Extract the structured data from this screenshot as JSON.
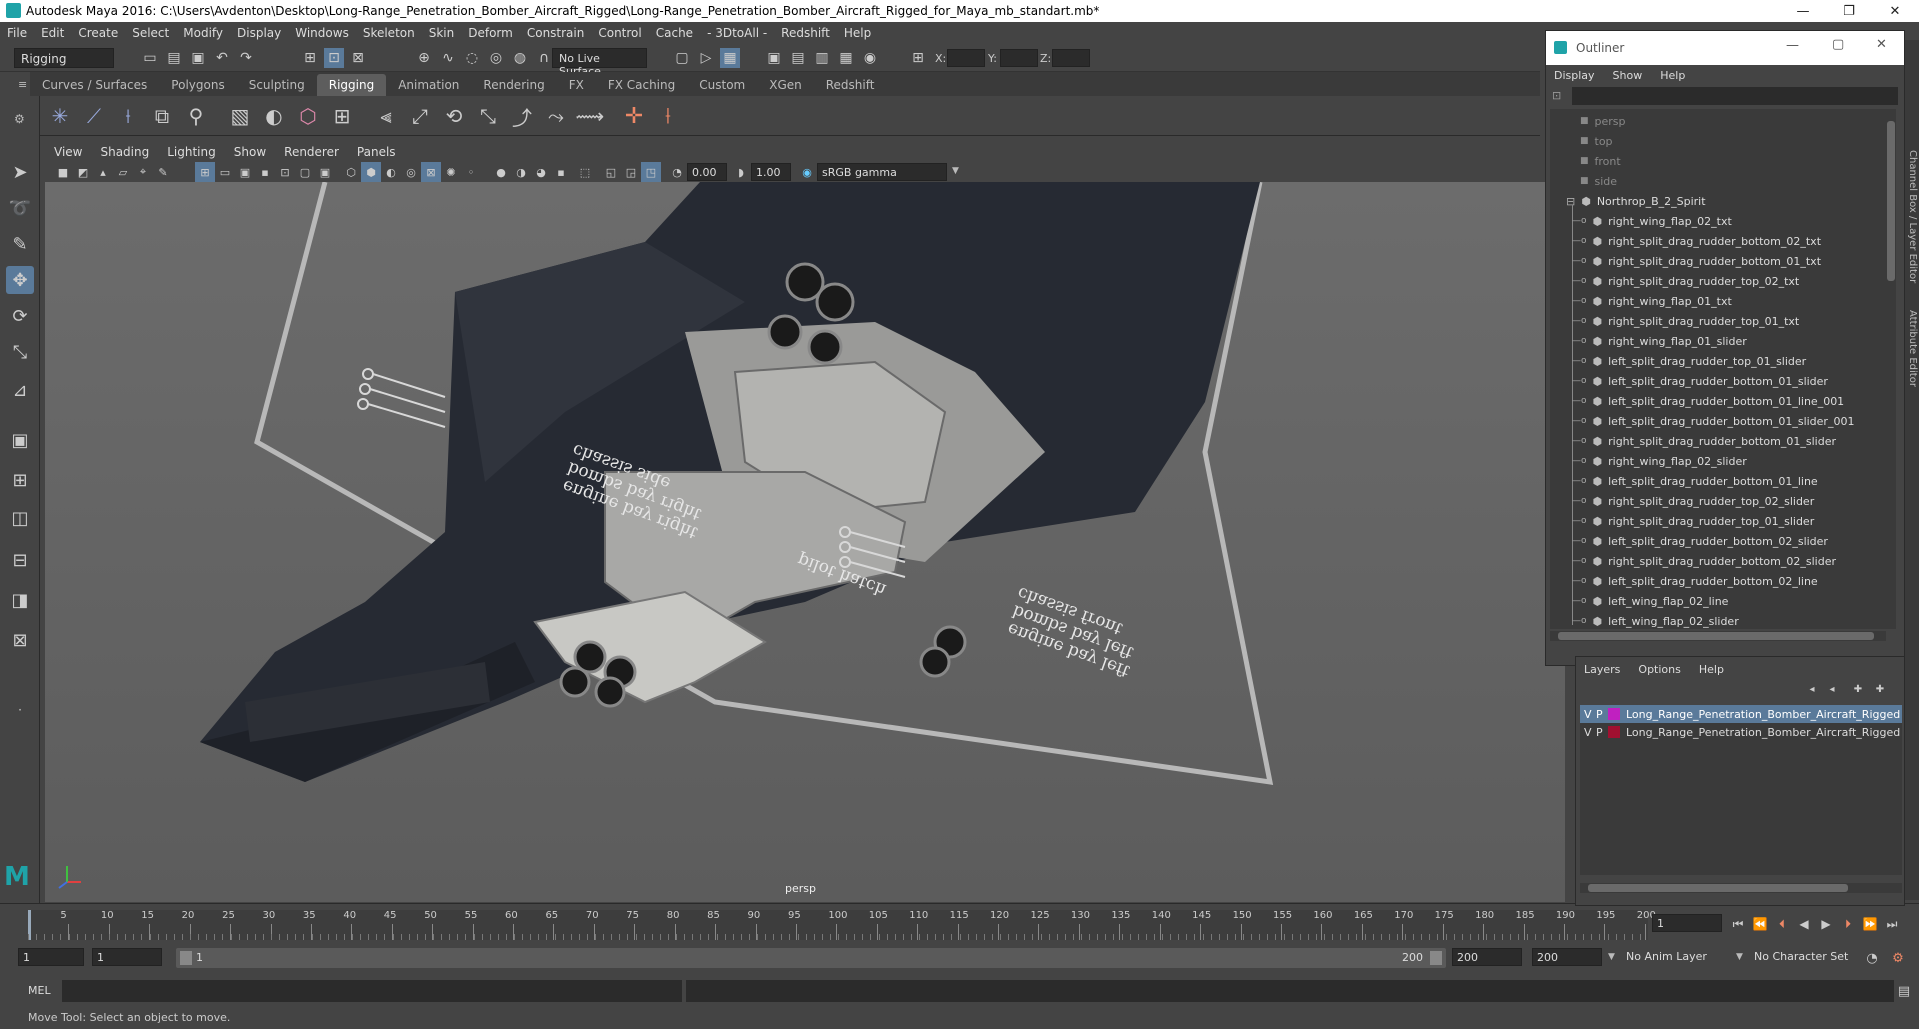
{
  "app": {
    "title": "Autodesk Maya 2016: C:\\Users\\Avdenton\\Desktop\\Long-Range_Penetration_Bomber_Aircraft_Rigged\\Long-Range_Penetration_Bomber_Aircraft_Rigged_for_Maya_mb_standart.mb*"
  },
  "menu": [
    "File",
    "Edit",
    "Create",
    "Select",
    "Modify",
    "Display",
    "Windows",
    "Skeleton",
    "Skin",
    "Deform",
    "Constrain",
    "Control",
    "Cache",
    "- 3DtoAll -",
    "Redshift",
    "Help"
  ],
  "status": {
    "mode": "Rigging",
    "live_surface": "No Live Surface",
    "x_label": "X:",
    "y_label": "Y:",
    "z_label": "Z:"
  },
  "shelf_tabs": [
    "Curves / Surfaces",
    "Polygons",
    "Sculpting",
    "Rigging",
    "Animation",
    "Rendering",
    "FX",
    "FX Caching",
    "Custom",
    "XGen",
    "Redshift"
  ],
  "viewport_menu": [
    "View",
    "Shading",
    "Lighting",
    "Show",
    "Renderer",
    "Panels"
  ],
  "viewport_toolbar": {
    "exposure": "0.00",
    "gamma": "1.00",
    "color_space": "sRGB gamma"
  },
  "viewport": {
    "camera": "persp",
    "labels_left": [
      "chassis side",
      "bombs bay right",
      "engine bay right"
    ],
    "labels_right": [
      "chassis front",
      "bombs bay left",
      "engine bay left"
    ],
    "label_pilot": "pilot hatch"
  },
  "outliner": {
    "title": "Outliner",
    "menu": [
      "Display",
      "Show",
      "Help"
    ],
    "cameras": [
      "persp",
      "top",
      "front",
      "side"
    ],
    "root": "Northrop_B_2_Spirit",
    "items": [
      "right_wing_flap_02_txt",
      "right_split_drag_rudder_bottom_02_txt",
      "right_split_drag_rudder_bottom_01_txt",
      "right_split_drag_rudder_top_02_txt",
      "right_wing_flap_01_txt",
      "right_split_drag_rudder_top_01_txt",
      "right_wing_flap_01_slider",
      "left_split_drag_rudder_top_01_slider",
      "left_split_drag_rudder_bottom_01_slider",
      "left_split_drag_rudder_bottom_01_line_001",
      "left_split_drag_rudder_bottom_01_slider_001",
      "right_split_drag_rudder_bottom_01_slider",
      "right_wing_flap_02_slider",
      "left_split_drag_rudder_bottom_01_line",
      "right_split_drag_rudder_top_02_slider",
      "right_split_drag_rudder_top_01_slider",
      "left_split_drag_rudder_bottom_02_slider",
      "right_split_drag_rudder_bottom_02_slider",
      "left_split_drag_rudder_bottom_02_line",
      "left_wing_flap_02_line",
      "left_wing_flap_02_slider"
    ]
  },
  "layers": {
    "menu": [
      "Layers",
      "Options",
      "Help"
    ],
    "rows": [
      {
        "v": "V",
        "p": "P",
        "name": "Long_Range_Penetration_Bomber_Aircraft_Rigged",
        "color": "#c020c0"
      },
      {
        "v": "V",
        "p": "P",
        "name": "Long_Range_Penetration_Bomber_Aircraft_Rigged",
        "color": "#a01030"
      }
    ]
  },
  "side_tabs": [
    "Channel Box / Layer Editor",
    "Attribute Editor"
  ],
  "timeline": {
    "ticks": [
      "5",
      "10",
      "15",
      "20",
      "25",
      "30",
      "35",
      "40",
      "45",
      "50",
      "55",
      "60",
      "65",
      "70",
      "75",
      "80",
      "85",
      "90",
      "95",
      "100",
      "105",
      "110",
      "115",
      "120",
      "125",
      "130",
      "135",
      "140",
      "145",
      "150",
      "155",
      "160",
      "165",
      "170",
      "175",
      "180",
      "185",
      "190",
      "195",
      "200"
    ],
    "current_frame": "1"
  },
  "range": {
    "start": "1",
    "start2": "1",
    "slider_start": "1",
    "slider_end": "200",
    "end": "200",
    "end2": "200",
    "anim_layer": "No Anim Layer",
    "char_set": "No Character Set"
  },
  "cmd": {
    "label": "MEL"
  },
  "help": "Move Tool: Select an object to move."
}
